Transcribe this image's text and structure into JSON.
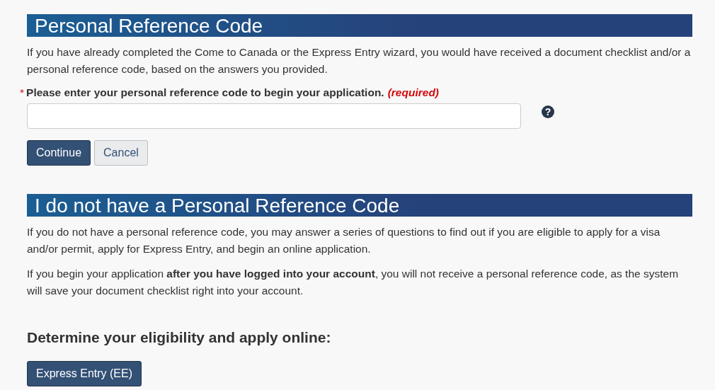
{
  "code_section": {
    "heading": "Personal Reference Code",
    "intro": "If you have already completed the Come to Canada or the Express Entry wizard, you would have received a document checklist and/or a personal reference code, based on the answers you provided.",
    "field": {
      "required_mark": "*",
      "label": "Please enter your personal reference code to begin your application.",
      "required_note": "(required)",
      "help": "?"
    },
    "buttons": [
      {
        "label": "Continue",
        "kind": "primary"
      },
      {
        "label": "Cancel",
        "kind": "secondary"
      }
    ]
  },
  "no_code_section": {
    "heading": "I do not have a Personal Reference Code",
    "paragraphs": [
      "If you do not have a personal reference code, you may answer a series of questions to find out if you are eligible to apply for a visa and/or permit, apply for Express Entry, and begin an online application.",
      "If you begin your application **after you have logged into your account**, you will not receive a personal reference code, as the system will save your document checklist right into your account."
    ],
    "subheading": "Determine your eligibility and apply online:",
    "buttons": [
      {
        "label": "Express Entry (EE)",
        "kind": "primary"
      }
    ]
  }
}
